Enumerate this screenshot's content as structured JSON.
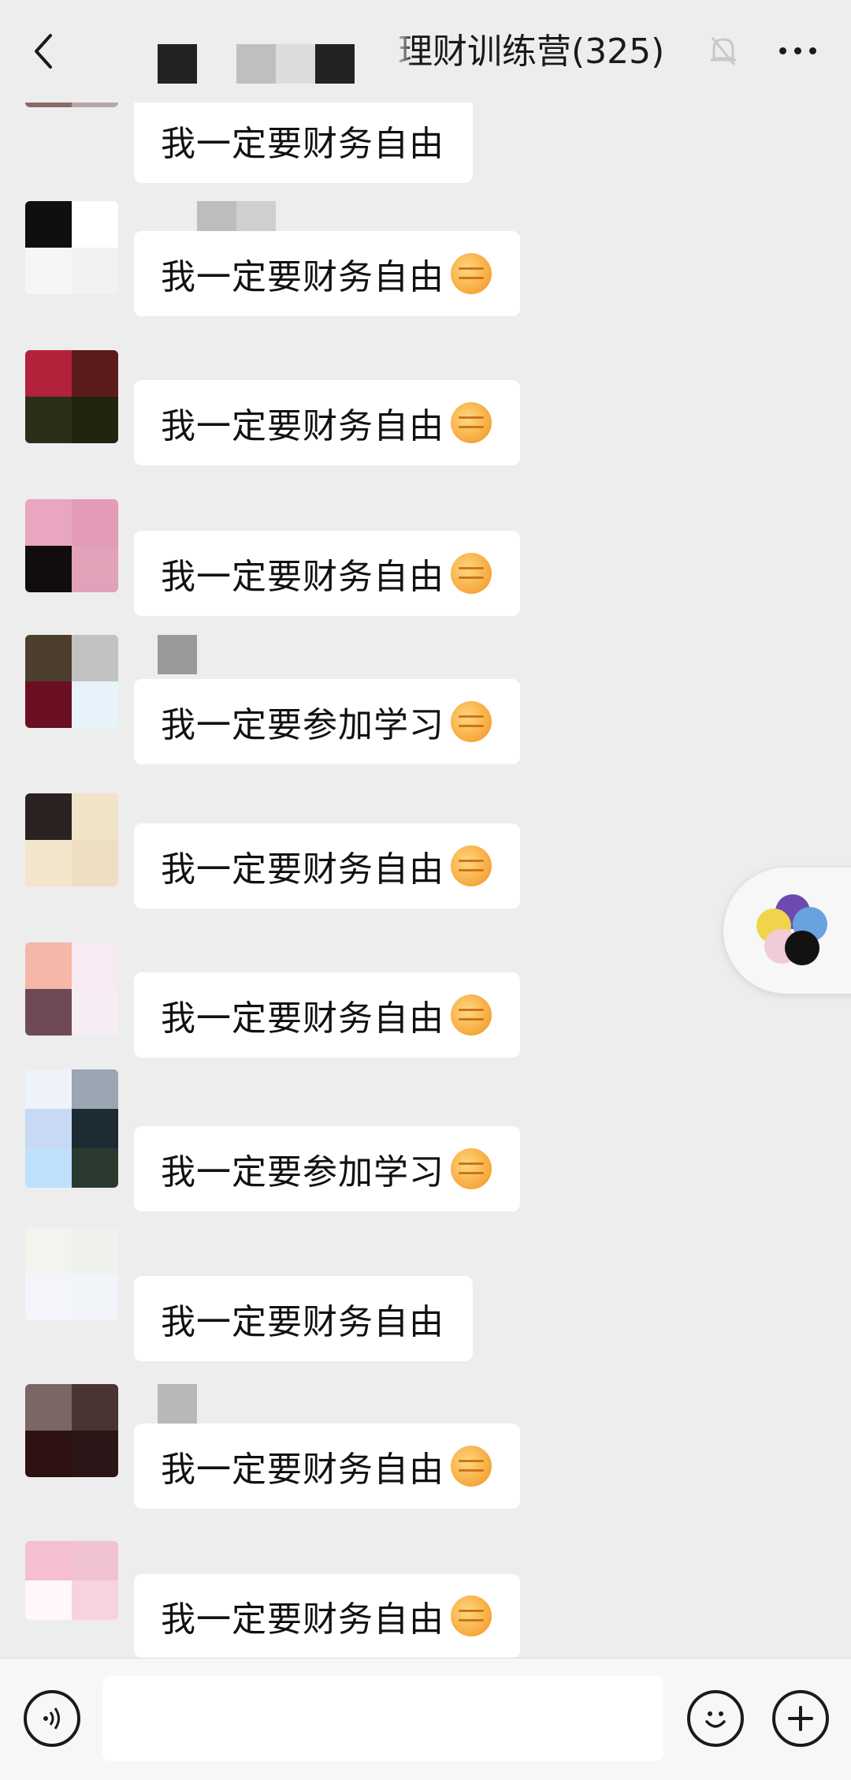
{
  "header": {
    "title": "理财训练营(325)",
    "back_icon": "chevron-left-icon",
    "mute_icon": "bell-off-icon",
    "more_icon": "more-horizontal-icon"
  },
  "messages": [
    {
      "text": "我一定要财务自由",
      "emoji": ""
    },
    {
      "text": "我一定要财务自由",
      "emoji": "fist"
    },
    {
      "text": "我一定要财务自由",
      "emoji": "fist"
    },
    {
      "text": "我一定要财务自由",
      "emoji": "fist"
    },
    {
      "text": "我一定要参加学习",
      "emoji": "fist"
    },
    {
      "text": "我一定要财务自由",
      "emoji": "fist"
    },
    {
      "text": "我一定要财务自由",
      "emoji": "fist"
    },
    {
      "text": "我一定要参加学习",
      "emoji": "fist"
    },
    {
      "text": "我一定要财务自由",
      "emoji": ""
    },
    {
      "text": "我一定要财务自由",
      "emoji": "fist"
    },
    {
      "text": "我一定要财务自由",
      "emoji": "fist"
    }
  ],
  "input_bar": {
    "voice_icon": "voice-icon",
    "emoji_icon": "smiley-icon",
    "plus_icon": "plus-circle-icon",
    "input_value": ""
  },
  "colors": {
    "background": "#ededed",
    "bubble": "#ffffff",
    "text": "#111111"
  }
}
